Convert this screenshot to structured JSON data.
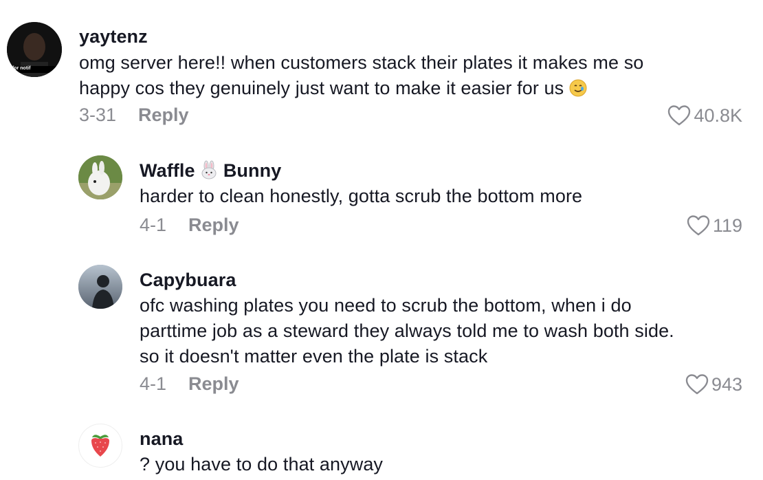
{
  "comments": [
    {
      "username": "yaytenz",
      "text_line1": "omg server here!! when customers stack their plates it makes me so",
      "text_line2": "happy cos they genuinely just want to make it easier for us",
      "date": "3-31",
      "reply_label": "Reply",
      "likes": "40.8K",
      "avatar_caption": "for notif"
    },
    {
      "username_part1": "Waffle",
      "username_part2": "Bunny",
      "text": "harder to clean honestly, gotta scrub the bottom more",
      "date": "4-1",
      "reply_label": "Reply",
      "likes": "119"
    },
    {
      "username": "Capybuara",
      "text_line1": "ofc washing plates you need to scrub the bottom, when i do",
      "text_line2": "parttime job as a steward they always told me to wash both side.",
      "text_line3": "so it doesn't matter even the plate is stack",
      "date": "4-1",
      "reply_label": "Reply",
      "likes": "943"
    },
    {
      "username": "nana",
      "text": "? you have to do that anyway"
    }
  ],
  "colors": {
    "text": "#161823",
    "meta": "#8a8b91"
  },
  "icons": [
    "heart-icon",
    "rabbit-emoji-icon",
    "smiling-tear-emoji-icon",
    "strawberry-icon"
  ]
}
